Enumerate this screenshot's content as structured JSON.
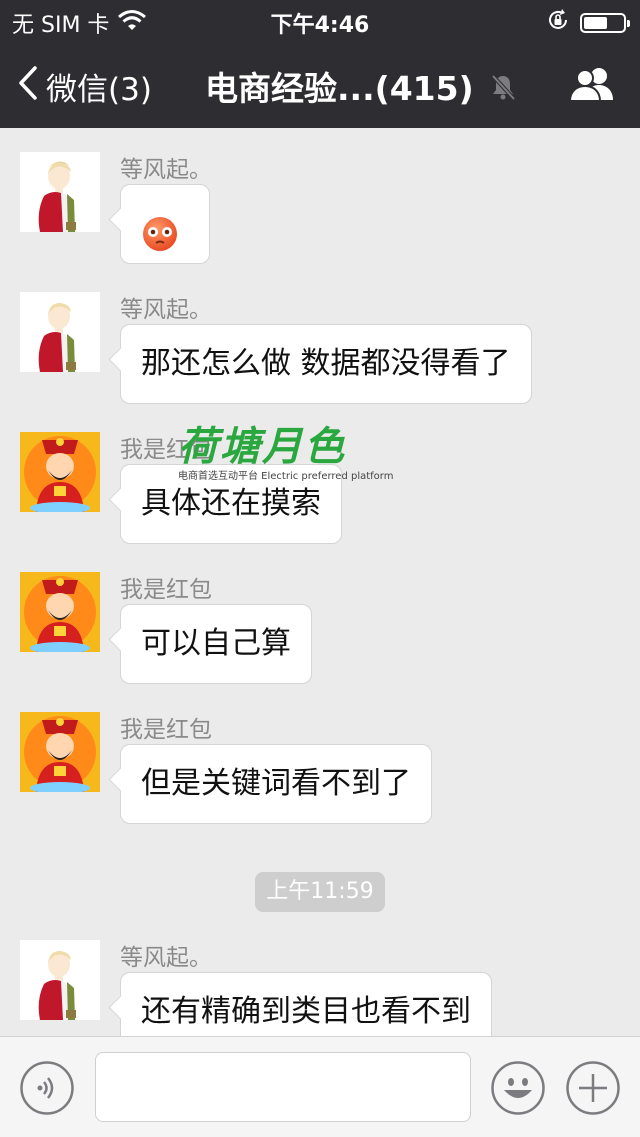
{
  "status_bar": {
    "carrier": "无 SIM 卡",
    "time": "下午4:46",
    "battery_level": 0.6
  },
  "nav": {
    "back_label": "微信(3)",
    "title": "电商经验...(415)"
  },
  "watermark": {
    "brand": "荷塘月色",
    "tagline": "电商首选互动平台 Electric preferred platform"
  },
  "messages": [
    {
      "sender": "等风起。",
      "avatar": "boy-avatar",
      "content": "",
      "emoji": "flushed-face-emoji"
    },
    {
      "sender": "等风起。",
      "avatar": "boy-avatar",
      "content": "那还怎么做 数据都没得看了"
    },
    {
      "sender": "我是红包",
      "avatar": "god-of-wealth-avatar",
      "content": "具体还在摸索"
    },
    {
      "sender": "我是红包",
      "avatar": "god-of-wealth-avatar",
      "content": "可以自己算"
    },
    {
      "sender": "我是红包",
      "avatar": "god-of-wealth-avatar",
      "content": "但是关键词看不到了"
    },
    {
      "sender": "等风起。",
      "avatar": "boy-avatar",
      "content": "还有精确到类目也看不到"
    }
  ],
  "timestamp": "上午11:59",
  "input_bar": {
    "placeholder": ""
  },
  "colors": {
    "nav_bg": "#2e2e32",
    "chat_bg": "#ebebeb",
    "bubble_bg": "#ffffff",
    "watermark_green": "#2aa73f"
  }
}
